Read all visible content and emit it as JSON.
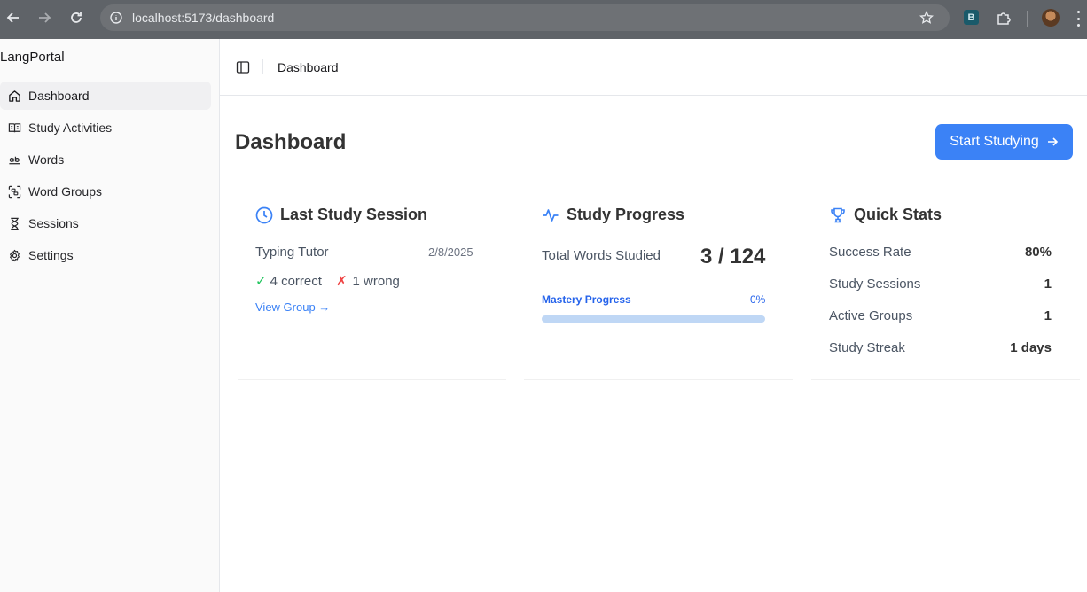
{
  "browser": {
    "url": "localhost:5173/dashboard",
    "extension_letter": "B"
  },
  "sidebar": {
    "brand": "LangPortal",
    "items": [
      {
        "label": "Dashboard",
        "icon": "home-icon",
        "active": true
      },
      {
        "label": "Study Activities",
        "icon": "book-open-icon",
        "active": false
      },
      {
        "label": "Words",
        "icon": "words-icon",
        "active": false
      },
      {
        "label": "Word Groups",
        "icon": "group-icon",
        "active": false
      },
      {
        "label": "Sessions",
        "icon": "hourglass-icon",
        "active": false
      },
      {
        "label": "Settings",
        "icon": "gear-icon",
        "active": false
      }
    ]
  },
  "header": {
    "breadcrumb": "Dashboard"
  },
  "main": {
    "title": "Dashboard",
    "start_button": "Start Studying",
    "last_session": {
      "title": "Last Study Session",
      "activity": "Typing Tutor",
      "date": "2/8/2025",
      "correct_mark": "✓",
      "correct": "4 correct",
      "wrong_mark": "✗",
      "wrong": "1 wrong",
      "link": "View Group →"
    },
    "study_progress": {
      "title": "Study Progress",
      "total_label": "Total Words Studied",
      "total_value": "3 / 124",
      "mastery_label": "Mastery Progress",
      "mastery_percent_text": "0%",
      "mastery_fraction": 0
    },
    "quick_stats": {
      "title": "Quick Stats",
      "rows": [
        {
          "label": "Success Rate",
          "value": "80%"
        },
        {
          "label": "Study Sessions",
          "value": "1"
        },
        {
          "label": "Active Groups",
          "value": "1"
        },
        {
          "label": "Study Streak",
          "value": "1 days"
        }
      ]
    }
  },
  "colors": {
    "accent": "#3b82f6",
    "success": "#22c55e",
    "danger": "#ef4444",
    "progress_track": "#bfd7f5"
  }
}
